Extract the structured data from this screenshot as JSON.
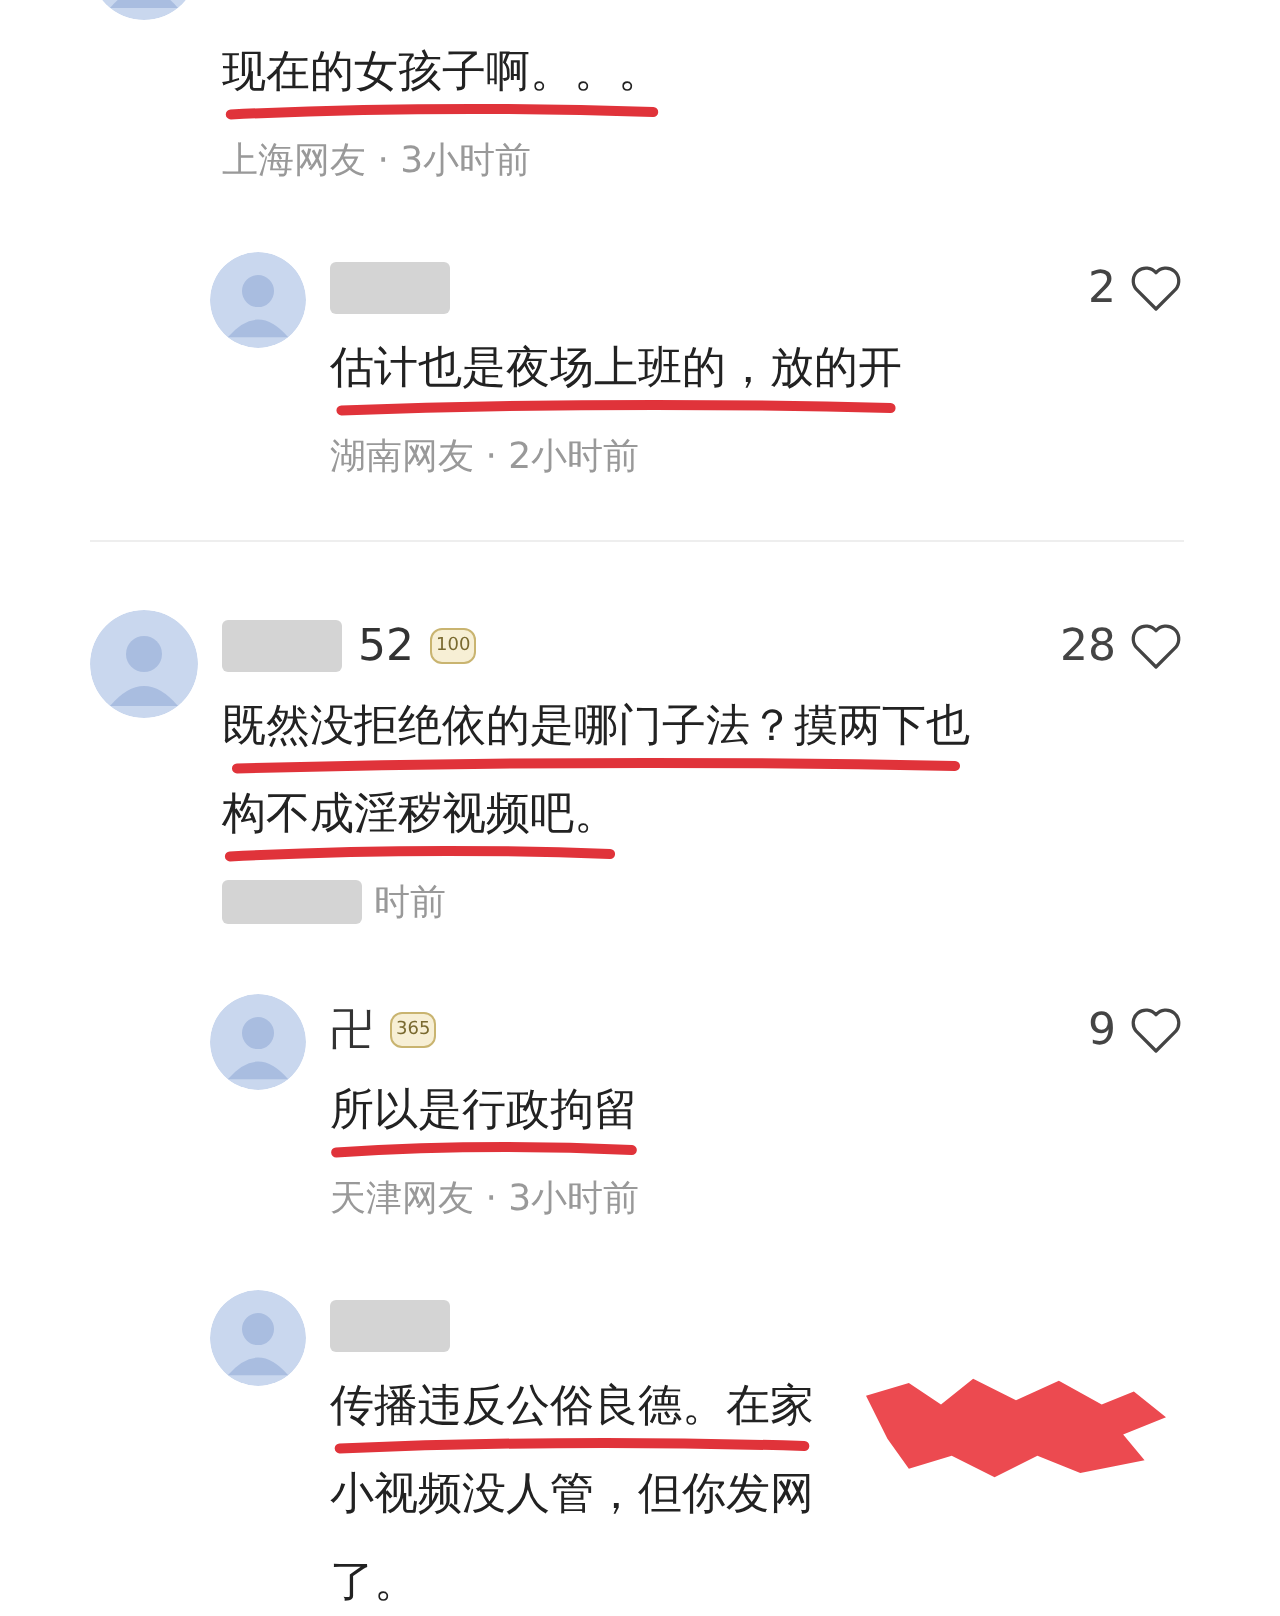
{
  "comments": [
    {
      "kind": "top",
      "cut_top": true,
      "name_blurred": false,
      "lines": [
        {
          "text": "现在的女孩子啊。。。",
          "underlined": true
        }
      ],
      "meta": "上海网友 · 3小时前",
      "meta_blurred": false,
      "redacted": false
    },
    {
      "kind": "reply",
      "cut_top": false,
      "name_blurred": true,
      "likes": "2",
      "lines": [
        {
          "text": "估计也是夜场上班的，放的开",
          "underlined": true
        }
      ],
      "meta": "湖南网友 · 2小时前",
      "meta_blurred": false,
      "redacted": false
    },
    {
      "kind": "top",
      "cut_top": false,
      "name_blurred": true,
      "name": "52",
      "badge": "100",
      "likes": "28",
      "lines": [
        {
          "text": "既然没拒绝依的是哪门子法？摸两下也",
          "underlined": true
        },
        {
          "text": "构不成淫秽视频吧。",
          "underlined": true
        }
      ],
      "meta": "时前",
      "meta_blurred": true,
      "redacted": false
    },
    {
      "kind": "reply",
      "cut_top": false,
      "name_blurred": false,
      "name": "卍",
      "badge": "365",
      "likes": "9",
      "lines": [
        {
          "text": "所以是行政拘留",
          "underlined": true
        }
      ],
      "meta": "天津网友 · 3小时前",
      "meta_blurred": false,
      "redacted": false
    },
    {
      "kind": "reply",
      "cut_top": false,
      "name_blurred": true,
      "lines": [
        {
          "text": "传播违反公俗良德。在家",
          "underlined": true
        },
        {
          "text": "小视频没人管，但你发网",
          "underlined": false
        },
        {
          "text": "了。",
          "underlined": false
        }
      ],
      "redacted": true
    }
  ]
}
